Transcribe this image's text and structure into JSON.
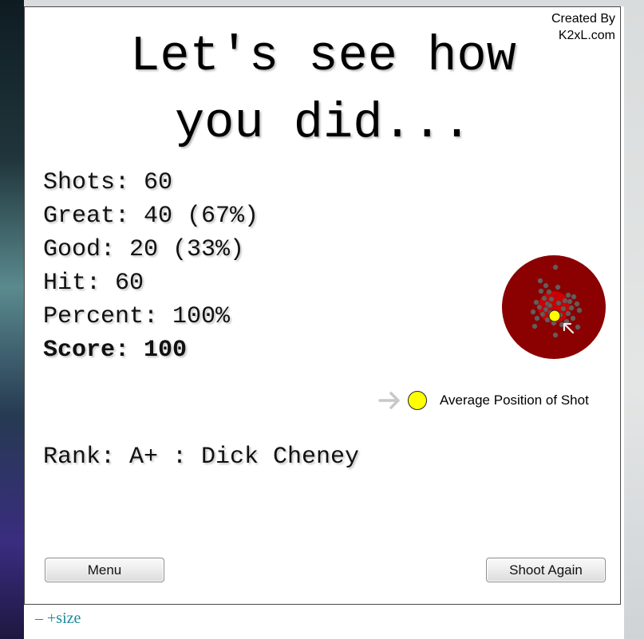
{
  "credit": {
    "line1": "Created By",
    "line2": "K2xL.com"
  },
  "title": {
    "line1": "Let's see how",
    "line2": "you did..."
  },
  "stats": {
    "shots": "Shots: 60",
    "great": "Great: 40 (67%)",
    "good": "Good: 20 (33%)",
    "hit": "Hit: 60",
    "percent": "Percent: 100%",
    "score": "Score: 100"
  },
  "legend": {
    "label": "Average Position of Shot"
  },
  "rank": {
    "text": "Rank: A+ : Dick Cheney"
  },
  "buttons": {
    "menu": "Menu",
    "shoot_again": "Shoot Again"
  },
  "size_controls": {
    "decrease": "–",
    "increase": "+size"
  },
  "colors": {
    "target_outer": "#8b0000",
    "target_inner": "#cc0000",
    "shot_dot": "#6b5a5a",
    "average_dot": "#ffff00",
    "size_link": "#1a8a9a"
  },
  "icons": {
    "legend_arrow": "right-arrow-icon",
    "cursor": "mouse-cursor-icon"
  }
}
